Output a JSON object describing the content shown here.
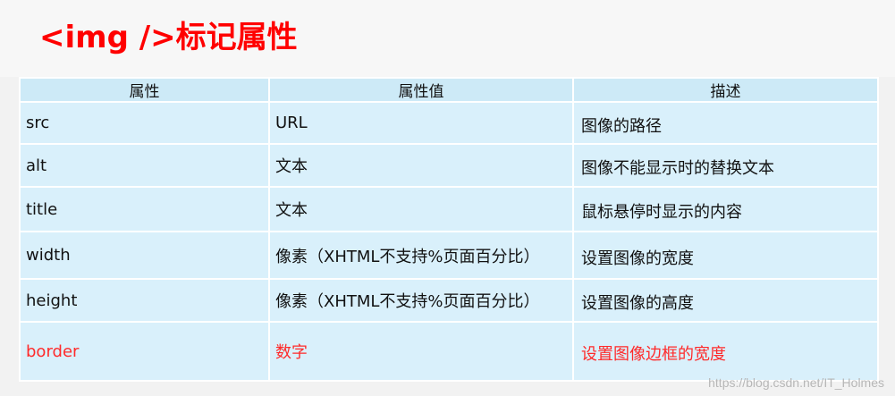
{
  "title": "<img />标记属性",
  "table": {
    "headers": [
      "属性",
      "属性值",
      "描述"
    ],
    "rows": [
      {
        "attr": "src",
        "value": "URL",
        "desc": "图像的路径"
      },
      {
        "attr": "alt",
        "value": "文本",
        "desc": "图像不能显示时的替换文本"
      },
      {
        "attr": "title",
        "value": "文本",
        "desc": "鼠标悬停时显示的内容"
      },
      {
        "attr": "width",
        "value": "像素（XHTML不支持%页面百分比）",
        "desc": "设置图像的宽度"
      },
      {
        "attr": "height",
        "value": "像素（XHTML不支持%页面百分比）",
        "desc": "设置图像的高度"
      },
      {
        "attr": "border",
        "value": "数字",
        "desc": "设置图像边框的宽度"
      }
    ]
  },
  "watermark": "https://blog.csdn.net/IT_Holmes",
  "colors": {
    "title": "#ff0000",
    "highlight_row": "#ff2a2a",
    "table_bg": "#d9f0fb"
  }
}
